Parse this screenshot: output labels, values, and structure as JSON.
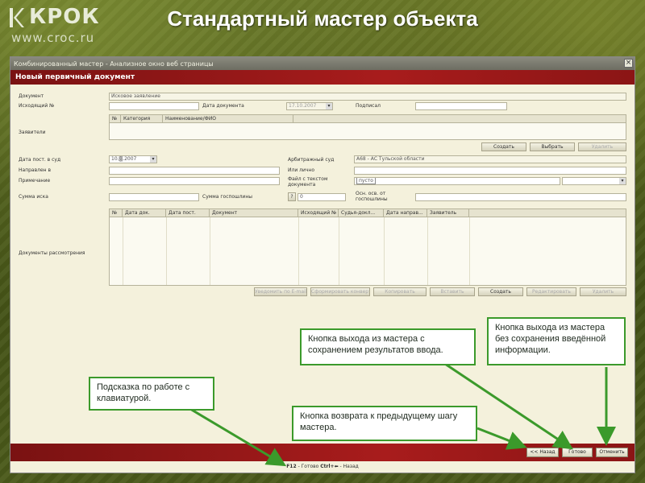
{
  "logo": {
    "brand": "КРОК",
    "url": "www.croc.ru"
  },
  "slide": {
    "title": "Стандартный мастер объекта"
  },
  "window": {
    "title": "Комбинированный мастер - Анализное окно веб страницы",
    "close_label": "×",
    "doc_title": "Новый первичный документ"
  },
  "form": {
    "document_label": "Документ",
    "document_value": "Исковое заявление",
    "outgoing_label": "Исходящий №",
    "outgoing_value": "",
    "doc_date_label": "Дата документа",
    "doc_date_value": "17.10.2007",
    "signed_label": "Подписал",
    "signed_value": "",
    "applicants_label": "Заявители",
    "applicants_columns": [
      "№",
      "Категория",
      "Наименование/ФИО"
    ],
    "applicants_buttons": [
      {
        "label": "Создать",
        "disabled": false
      },
      {
        "label": "Выбрать",
        "disabled": false
      },
      {
        "label": "Удалить",
        "disabled": true
      }
    ],
    "court_date_label": "Дата пост. в суд",
    "court_date_value": "10.▒.2007",
    "arbitration_label": "Арбитражный суд",
    "arbitration_value": "А68 - АС Тульской области",
    "directed_label": "Направлен в",
    "directed_value": "",
    "or_personally_label": "Или лично",
    "or_personally_value": "",
    "note_label": "Примечание",
    "note_value": "",
    "text_file_label": "Файл с текстом документа",
    "text_file_value": "пусто",
    "claim_sum_label": "Сумма иска",
    "claim_sum_value": "",
    "duty_sum_label": "Сумма госпошлины",
    "duty_help": "?",
    "duty_value": "0",
    "exempt_label": "Осн. осв. от госпошлины",
    "exempt_value": "",
    "review_docs_label": "Документы рассмотрения",
    "review_columns": [
      "№",
      "Дата док.",
      "Дата пост.",
      "Документ",
      "Исходящий №",
      "Судья-докл...",
      "Дата направ...",
      "Заявитель"
    ],
    "review_buttons": [
      {
        "label": "Уведомить по E-mail",
        "disabled": true
      },
      {
        "label": "Сформировать конверт",
        "disabled": true
      },
      {
        "label": "Копировать",
        "disabled": true
      },
      {
        "label": "Вставить",
        "disabled": true
      },
      {
        "label": "Создать",
        "disabled": false
      },
      {
        "label": "Редактировать",
        "disabled": true
      },
      {
        "label": "Удалить",
        "disabled": true
      }
    ]
  },
  "nav": {
    "back_label": "<< Назад",
    "done_label": "Готово",
    "cancel_label": "Отменить",
    "hint_key1": "F12",
    "hint_text1": " - Готово ",
    "hint_key2": "Ctrl+⬅",
    "hint_text2": " - Назад"
  },
  "callouts": {
    "keyboard_hint": "Подсказка по работе с клавиатурой.",
    "back_hint": "Кнопка возврата к предыдущему шагу мастера.",
    "save_exit": "Кнопка выхода из мастера с сохранением результатов ввода.",
    "nosave_exit": "Кнопка выхода из мастера без сохранения введённой информации."
  },
  "colors": {
    "header_red": "#a81c1c",
    "callout_green": "#3b9a2b",
    "background_olive": "#4b5a1a"
  }
}
